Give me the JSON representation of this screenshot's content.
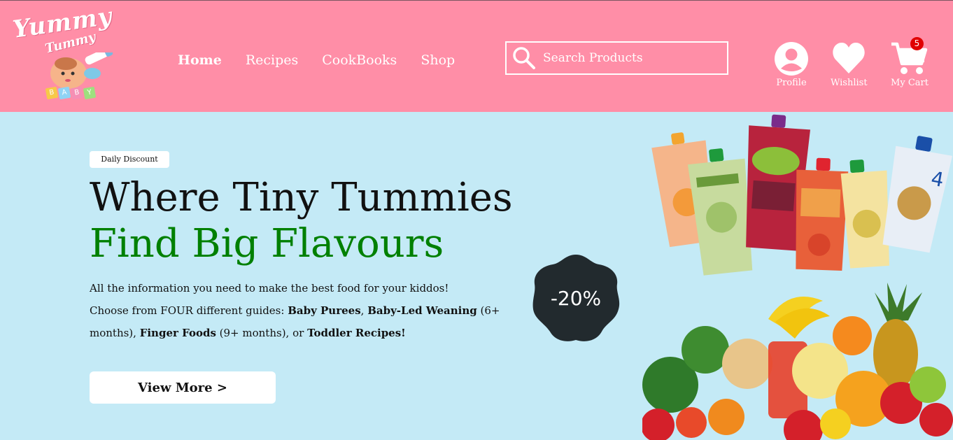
{
  "brand": {
    "word1": "Yummy",
    "word2": "Tummy",
    "blocks": [
      "B",
      "A",
      "B",
      "Y"
    ]
  },
  "nav": {
    "items": [
      {
        "label": "Home",
        "active": true
      },
      {
        "label": "Recipes",
        "active": false
      },
      {
        "label": "CookBooks",
        "active": false
      },
      {
        "label": "Shop",
        "active": false
      }
    ]
  },
  "search": {
    "placeholder": "Search Products",
    "icon": "search-icon"
  },
  "header_icons": {
    "profile": {
      "label": "Profile",
      "icon": "user-icon"
    },
    "wishlist": {
      "label": "Wishlist",
      "icon": "heart-icon"
    },
    "cart": {
      "label": "My Cart",
      "icon": "cart-icon",
      "count": "5"
    }
  },
  "hero": {
    "tag": "Daily Discount",
    "title_line1": "Where Tiny Tummies",
    "title_line2": "Find Big Flavours",
    "desc_line1": "All the information you need to make the best food for your kiddos!",
    "desc_prefix": "Choose from FOUR different guides: ",
    "guide1": "Baby Purees",
    "sep1": ", ",
    "guide2": "Baby-Led Weaning",
    "age2": " (6+ months), ",
    "guide3": "Finger Foods",
    "age3": " (9+ months), or ",
    "guide4": "Toddler Recipes!",
    "cta_label": "View More  >",
    "discount": "-20%"
  },
  "colors": {
    "header_bg": "#ff8ea7",
    "hero_bg": "#c4eaf6",
    "accent_green": "#008000",
    "badge_red": "#e00000",
    "discount_blob": "#222a2e"
  }
}
